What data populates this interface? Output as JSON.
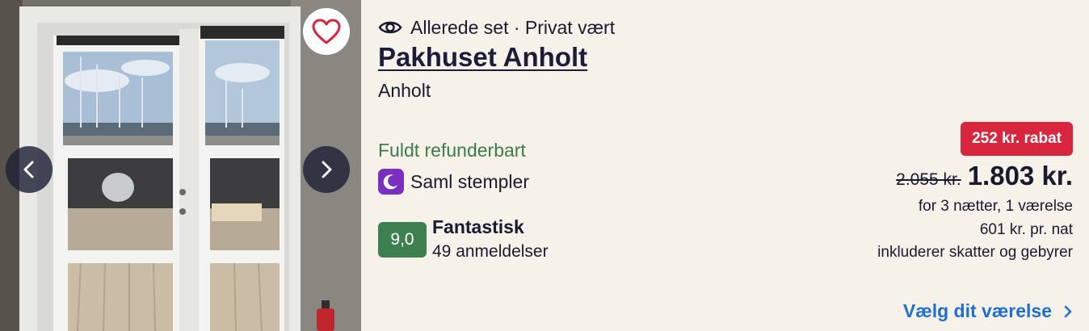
{
  "photo": {
    "favorite_icon": "heart-icon",
    "prev_icon": "chevron-left-icon",
    "next_icon": "chevron-right-icon"
  },
  "listing": {
    "seen_icon": "eye-icon",
    "seen_text": "Allerede set · Privat vært",
    "title": "Pakhuset Anholt",
    "location": "Anholt",
    "refund": "Fuldt refunderbart",
    "stamps_icon": "moon-icon",
    "stamps_label": "Saml stempler",
    "rating_score": "9,0",
    "rating_word": "Fantastisk",
    "rating_count": "49 anmeldelser"
  },
  "pricing": {
    "discount": "252 kr. rabat",
    "old_price": "2.055 kr.",
    "price": "1.803 kr.",
    "stay": "for 3 nætter, 1 værelse",
    "per_night": "601 kr. pr. nat",
    "taxes": "inkluderer skatter og gebyrer",
    "cta": "Vælg dit værelse"
  },
  "colors": {
    "background": "#f6f2ea",
    "refund_green": "#3d7a4a",
    "rating_green": "#3d7f4f",
    "discount_red": "#d7263d",
    "link_blue": "#1f6fd1",
    "stamps_purple": "#7a2fbf"
  }
}
